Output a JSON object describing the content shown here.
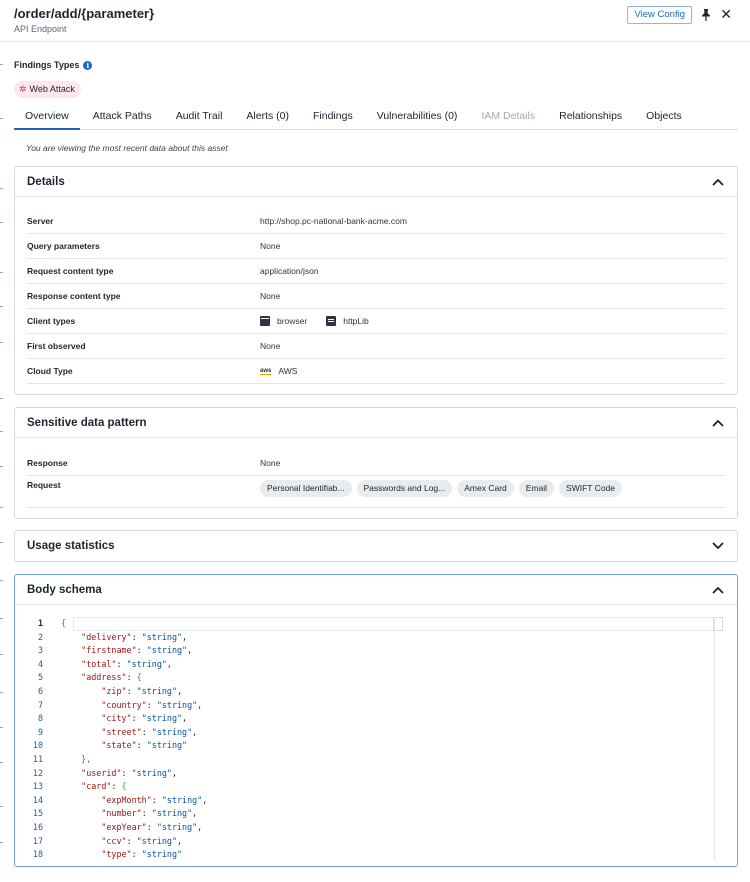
{
  "header": {
    "title": "/order/add/{parameter}",
    "subtitle": "API Endpoint",
    "view_config_label": "View Config"
  },
  "findings": {
    "label": "Findings Types",
    "chip": "Web Attack"
  },
  "tabs": [
    {
      "label": "Overview",
      "state": "active"
    },
    {
      "label": "Attack Paths",
      "state": "normal"
    },
    {
      "label": "Audit Trail",
      "state": "normal"
    },
    {
      "label": "Alerts (0)",
      "state": "normal"
    },
    {
      "label": "Findings",
      "state": "normal"
    },
    {
      "label": "Vulnerabilities (0)",
      "state": "normal"
    },
    {
      "label": "IAM Details",
      "state": "disabled"
    },
    {
      "label": "Relationships",
      "state": "normal"
    },
    {
      "label": "Objects",
      "state": "normal"
    }
  ],
  "recent_note": "You are viewing the most recent data about this asset",
  "details": {
    "title": "Details",
    "rows": [
      {
        "key": "Server",
        "value": "http://shop.pc-national-bank-acme.com"
      },
      {
        "key": "Query parameters",
        "value": "None"
      },
      {
        "key": "Request content type",
        "value": "application/json"
      },
      {
        "key": "Response content type",
        "value": "None"
      },
      {
        "key": "Client types",
        "value": ""
      },
      {
        "key": "First observed",
        "value": "None"
      },
      {
        "key": "Cloud Type",
        "value": "AWS"
      }
    ],
    "client_types": [
      "browser",
      "httpLib"
    ],
    "aws_icon_text": "aws"
  },
  "sensitive": {
    "title": "Sensitive data pattern",
    "response_label": "Response",
    "response_value": "None",
    "request_label": "Request",
    "request_pills": [
      "Personal Identifiab...",
      "Passwords and Log...",
      "Amex Card",
      "Email",
      "SWIFT Code"
    ]
  },
  "usage": {
    "title": "Usage statistics"
  },
  "body_schema": {
    "title": "Body schema",
    "lines": [
      {
        "n": "1",
        "indent": "",
        "k": "",
        "s": "",
        "tail": "{",
        "bracket": true
      },
      {
        "n": "2",
        "indent": "    ",
        "k": "\"delivery\"",
        "s": "\"string\"",
        "tail": ","
      },
      {
        "n": "3",
        "indent": "    ",
        "k": "\"firstname\"",
        "s": "\"string\"",
        "tail": ","
      },
      {
        "n": "4",
        "indent": "    ",
        "k": "\"total\"",
        "s": "\"string\"",
        "tail": ","
      },
      {
        "n": "5",
        "indent": "    ",
        "k": "\"address\"",
        "s": "",
        "tail": "{",
        "bracket_after": true
      },
      {
        "n": "6",
        "indent": "        ",
        "k": "\"zip\"",
        "s": "\"string\"",
        "tail": ","
      },
      {
        "n": "7",
        "indent": "        ",
        "k": "\"country\"",
        "s": "\"string\"",
        "tail": ","
      },
      {
        "n": "8",
        "indent": "        ",
        "k": "\"city\"",
        "s": "\"string\"",
        "tail": ","
      },
      {
        "n": "9",
        "indent": "        ",
        "k": "\"street\"",
        "s": "\"string\"",
        "tail": ","
      },
      {
        "n": "10",
        "indent": "        ",
        "k": "\"state\"",
        "s": "\"string\"",
        "tail": ""
      },
      {
        "n": "11",
        "indent": "    ",
        "k": "",
        "s": "",
        "tail": "},",
        "bracket": true
      },
      {
        "n": "12",
        "indent": "    ",
        "k": "\"userid\"",
        "s": "\"string\"",
        "tail": ","
      },
      {
        "n": "13",
        "indent": "    ",
        "k": "\"card\"",
        "s": "",
        "tail": "{",
        "bracket_after": true
      },
      {
        "n": "14",
        "indent": "        ",
        "k": "\"expMonth\"",
        "s": "\"string\"",
        "tail": ","
      },
      {
        "n": "15",
        "indent": "        ",
        "k": "\"number\"",
        "s": "\"string\"",
        "tail": ","
      },
      {
        "n": "16",
        "indent": "        ",
        "k": "\"expYear\"",
        "s": "\"string\"",
        "tail": ","
      },
      {
        "n": "17",
        "indent": "        ",
        "k": "\"ccv\"",
        "s": "\"string\"",
        "tail": ","
      },
      {
        "n": "18",
        "indent": "        ",
        "k": "\"type\"",
        "s": "\"string\"",
        "tail": ""
      }
    ]
  },
  "colors": {
    "accent": "#1a66c2",
    "chip_bg": "#fde8ee",
    "json_key": "#a31515",
    "json_string": "#0451a5",
    "json_bracket": "#319331"
  },
  "icons": {
    "pin": "pin-icon",
    "close": "close-icon",
    "info": "info-icon",
    "bug": "bug-icon",
    "chevron_up": "chevron-up-icon",
    "chevron_down": "chevron-down-icon"
  }
}
